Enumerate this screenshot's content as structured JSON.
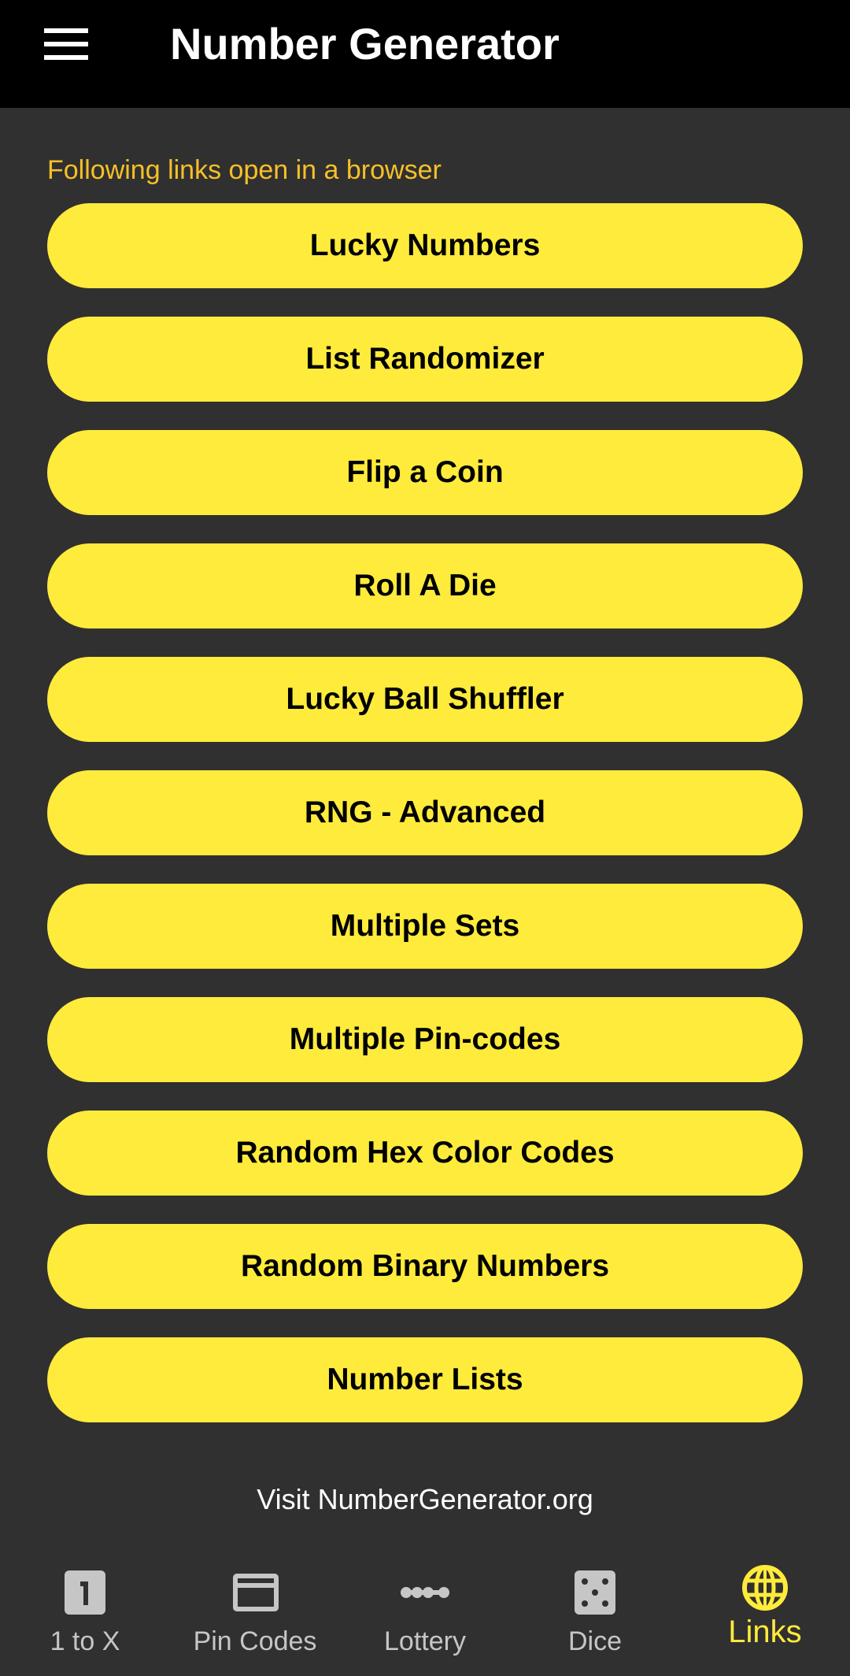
{
  "app_bar": {
    "title": "Number Generator",
    "menu_icon": "hamburger-menu-icon"
  },
  "content": {
    "subtitle": "Following links open in a browser",
    "links": [
      {
        "label": "Lucky Numbers"
      },
      {
        "label": "List Randomizer"
      },
      {
        "label": "Flip a Coin"
      },
      {
        "label": "Roll A Die"
      },
      {
        "label": "Lucky Ball Shuffler"
      },
      {
        "label": "RNG - Advanced"
      },
      {
        "label": "Multiple Sets"
      },
      {
        "label": "Multiple Pin-codes"
      },
      {
        "label": "Random Hex Color Codes"
      },
      {
        "label": "Random Binary Numbers"
      },
      {
        "label": "Number Lists"
      }
    ],
    "footer_link": "Visit NumberGenerator.org"
  },
  "bottom_nav": {
    "items": [
      {
        "label": "1 to X",
        "icon": "number-one-icon",
        "active": false
      },
      {
        "label": "Pin Codes",
        "icon": "card-icon",
        "active": false
      },
      {
        "label": "Lottery",
        "icon": "lottery-balls-icon",
        "active": false
      },
      {
        "label": "Dice",
        "icon": "dice-icon",
        "active": false
      },
      {
        "label": "Links",
        "icon": "globe-icon",
        "active": true
      }
    ]
  },
  "colors": {
    "app_bar_bg": "#000000",
    "background": "#303030",
    "accent_yellow": "#FFEB3B",
    "subtitle_color": "#F6C028",
    "nav_inactive": "#C6C6C6"
  }
}
